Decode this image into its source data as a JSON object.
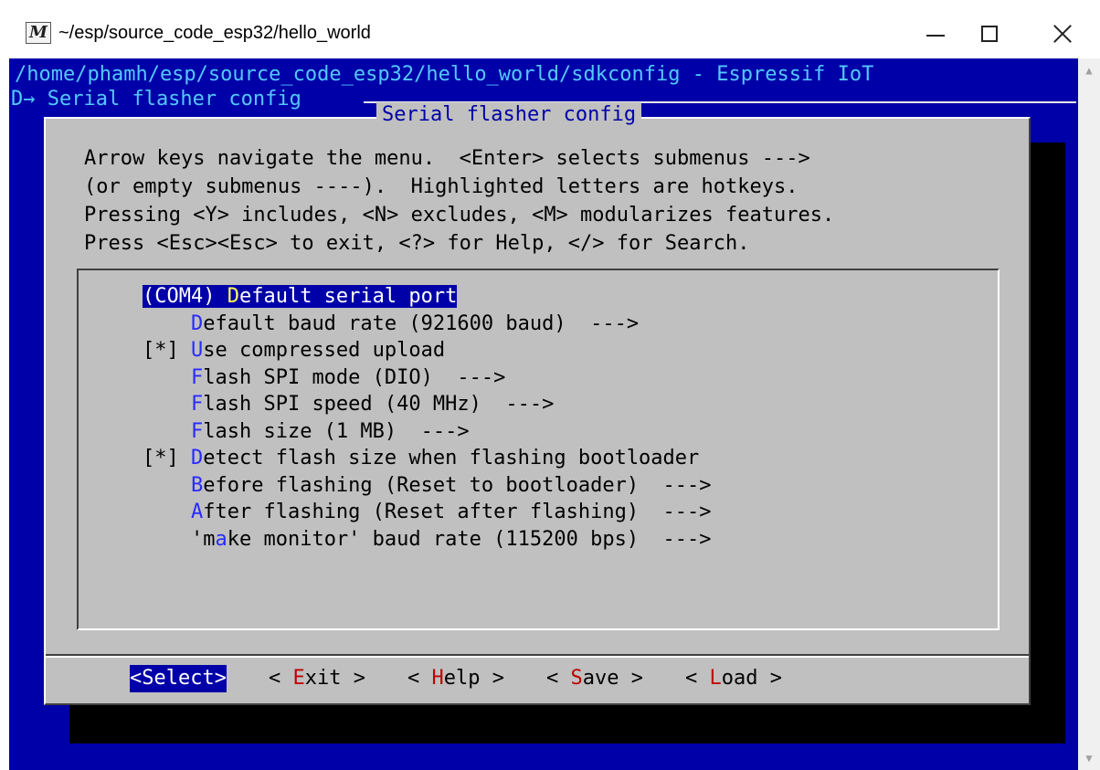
{
  "window": {
    "icon_letter": "M",
    "title": "~/esp/source_code_esp32/hello_world"
  },
  "terminal": {
    "path_line": "/home/phamh/esp/source_code_esp32/hello_world/sdkconfig - Espressif IoT",
    "breadcrumb": "D→ Serial flasher config "
  },
  "dialog": {
    "title": "Serial flasher config",
    "help_lines": [
      "Arrow keys navigate the menu.  <Enter> selects submenus --->",
      "(or empty submenus ----).  Highlighted letters are hotkeys.",
      "Pressing <Y> includes, <N> excludes, <M> modularizes features.",
      "Press <Esc><Esc> to exit, <?> for Help, </> for Search."
    ],
    "menu_items": [
      {
        "prefix": "(COM4) ",
        "hotkey": "D",
        "rest": "efault serial port",
        "selected": true
      },
      {
        "prefix": "    ",
        "hotkey": "D",
        "rest": "efault baud rate (921600 baud)  --->",
        "selected": false
      },
      {
        "prefix": "[*] ",
        "hotkey": "U",
        "rest": "se compressed upload",
        "selected": false
      },
      {
        "prefix": "    ",
        "hotkey": "F",
        "rest": "lash SPI mode (DIO)  --->",
        "selected": false
      },
      {
        "prefix": "    ",
        "hotkey": "F",
        "rest": "lash SPI speed (40 MHz)  --->",
        "selected": false
      },
      {
        "prefix": "    ",
        "hotkey": "F",
        "rest": "lash size (1 MB)  --->",
        "selected": false
      },
      {
        "prefix": "[*] ",
        "hotkey": "D",
        "rest": "etect flash size when flashing bootloader",
        "selected": false
      },
      {
        "prefix": "    ",
        "hotkey": "B",
        "rest": "efore flashing (Reset to bootloader)  --->",
        "selected": false
      },
      {
        "prefix": "    ",
        "hotkey": "A",
        "rest": "fter flashing (Reset after flashing)  --->",
        "selected": false
      },
      {
        "prefix": "    'm",
        "hotkey": "a",
        "rest": "ke monitor' baud rate (115200 bps)  --->",
        "selected": false
      }
    ],
    "buttons": [
      {
        "open": "<",
        "hotkey": "S",
        "rest": "elect",
        "close": ">",
        "active": true
      },
      {
        "open": "< ",
        "hotkey": "E",
        "rest": "xit",
        "close": " >",
        "active": false
      },
      {
        "open": "< ",
        "hotkey": "H",
        "rest": "elp",
        "close": " >",
        "active": false
      },
      {
        "open": "< ",
        "hotkey": "S",
        "rest": "ave",
        "close": " >",
        "active": false
      },
      {
        "open": "< ",
        "hotkey": "L",
        "rest": "oad",
        "close": " >",
        "active": false
      }
    ]
  },
  "colors": {
    "terminal_bg": "#0000a8",
    "dialog_bg": "#c0c0c0",
    "hotkey_blue": "#2a2aff",
    "hotkey_selected": "#ffff55",
    "button_hotkey_red": "#c00000"
  }
}
